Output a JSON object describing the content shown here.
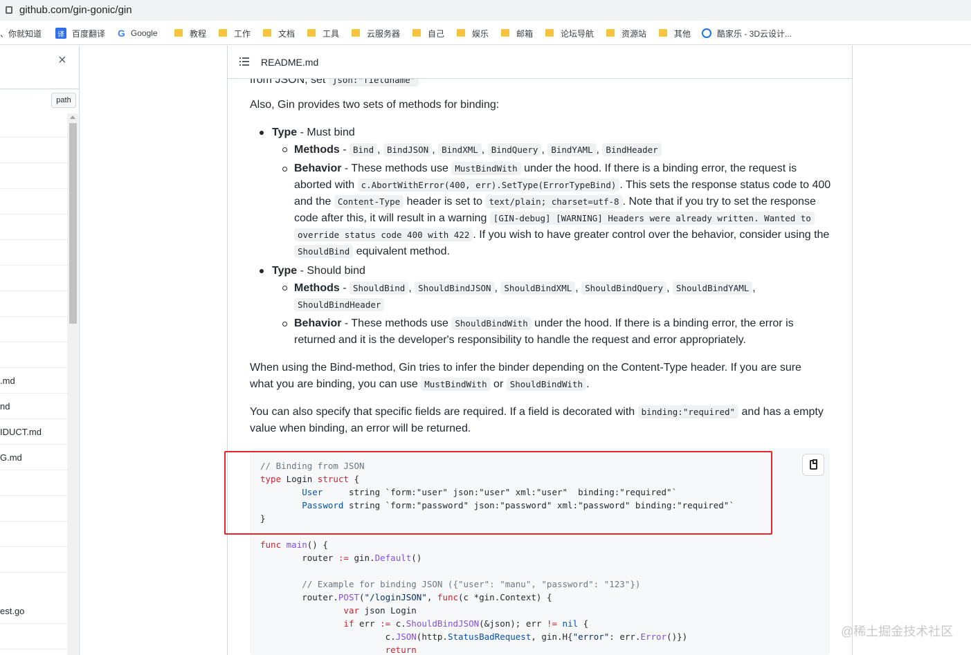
{
  "browser": {
    "url": "github.com/gin-gonic/gin",
    "bookmarks": [
      {
        "label": "、你就知道",
        "icon": "none"
      },
      {
        "label": "百度翻译",
        "icon": "baidu-translate-icon"
      },
      {
        "label": "Google",
        "icon": "google-icon"
      },
      {
        "label": "教程",
        "icon": "folder-icon"
      },
      {
        "label": "工作",
        "icon": "folder-icon"
      },
      {
        "label": "文档",
        "icon": "folder-icon"
      },
      {
        "label": "工具",
        "icon": "folder-icon"
      },
      {
        "label": "云服务器",
        "icon": "folder-icon"
      },
      {
        "label": "自己",
        "icon": "folder-icon"
      },
      {
        "label": "娱乐",
        "icon": "folder-icon"
      },
      {
        "label": "邮箱",
        "icon": "folder-icon"
      },
      {
        "label": "论坛导航",
        "icon": "folder-icon"
      },
      {
        "label": "资源站",
        "icon": "folder-icon"
      },
      {
        "label": "其他",
        "icon": "folder-icon"
      },
      {
        "label": "酷家乐 - 3D云设计...",
        "icon": "kujiale-icon"
      }
    ],
    "baidu_icon_char": "译",
    "google_icon_char": "G"
  },
  "file_panel": {
    "close_char": "×",
    "path_label": "path",
    "files": [
      ".md",
      "nd",
      "IDUCT.md",
      "G.md",
      "est.go"
    ]
  },
  "readme": {
    "title": "README.md",
    "cut_line": "from JSON, set",
    "cut_code": "json:\"fieldname\"",
    "intro": "Also, Gin provides two sets of methods for binding:",
    "type_label": "Type",
    "methods_label": "Methods",
    "behavior_label": "Behavior",
    "must": {
      "type": " - Must bind",
      "methods_dash": " - ",
      "methods": [
        "Bind",
        "BindJSON",
        "BindXML",
        "BindQuery",
        "BindYAML",
        "BindHeader"
      ],
      "b1_pre": " - These methods use ",
      "b1_code": "MustBindWith",
      "b1_post": " under the hood. If there is a binding error, the request is",
      "b2_pre": "aborted with ",
      "b2_code": "c.AbortWithError(400, err).SetType(ErrorTypeBind)",
      "b2_post": ". This sets the response status code to 400",
      "b3_pre": "and the ",
      "b3_code1": "Content-Type",
      "b3_mid": " header is set to ",
      "b3_code2": "text/plain; charset=utf-8",
      "b3_post": ". Note that if you try to set the response",
      "b4_pre": "code after this, it will result in a warning ",
      "b4_code": "[GIN-debug] [WARNING] Headers were already written. Wanted to",
      "b5_code": "override status code 400 with 422",
      "b5_post": ". If you wish to have greater control over the behavior, consider using the",
      "b6_code": "ShouldBind",
      "b6_post": " equivalent method."
    },
    "should": {
      "type": " - Should bind",
      "methods_dash": " - ",
      "methods": [
        "ShouldBind",
        "ShouldBindJSON",
        "ShouldBindXML",
        "ShouldBindQuery",
        "ShouldBindYAML"
      ],
      "methods2": "ShouldBindHeader",
      "b1_pre": " - These methods use ",
      "b1_code": "ShouldBindWith",
      "b1_post": " under the hood. If there is a binding error, the error is",
      "b2": "returned and it is the developer's responsibility to handle the request and error appropriately."
    },
    "p2_l1": "When using the Bind-method, Gin tries to infer the binder depending on the Content-Type header. If you are sure",
    "p2_l2_pre": "what you are binding, you can use ",
    "p2_l2_code1": "MustBindWith",
    "p2_l2_mid": " or ",
    "p2_l2_code2": "ShouldBindWith",
    "p2_l2_post": ".",
    "p3_l1_pre": "You can also specify that specific fields are required. If a field is decorated with ",
    "p3_l1_code": "binding:\"required\"",
    "p3_l1_post": " and has a empty",
    "p3_l2": "value when binding, an error will be returned."
  },
  "code": {
    "l1": "// Binding from JSON",
    "l2_k": "type",
    "l2_name": " Login ",
    "l2_k2": "struct",
    "l2_end": " {",
    "l3_field": "User",
    "l3_rest": "     string `form:\"user\" json:\"user\" xml:\"user\"  binding:\"required\"`",
    "l4_field": "Password",
    "l4_rest": " string `form:\"password\" json:\"password\" xml:\"password\" binding:\"required\"`",
    "l5": "}",
    "l7_k": "func",
    "l7_f": "main",
    "l7_end": "() {",
    "l8_pre": "router ",
    "l8_op": ":=",
    "l8_mid": " gin.",
    "l8_f": "Default",
    "l8_end": "()",
    "l10": "// Example for binding JSON ({\"user\": \"manu\", \"password\": \"123\"})",
    "l11_pre": "router.",
    "l11_f": "POST",
    "l11_s": "\"/loginJSON\"",
    "l11_k": "func",
    "l11_end": "(c *gin.Context) {",
    "l12_k": "var",
    "l12_rest": " json Login",
    "l13_k": "if",
    "l13_pre": " err ",
    "l13_op": ":=",
    "l13_mid": " c.",
    "l13_f": "ShouldBindJSON",
    "l13_mid2": "(&json); err ",
    "l13_op2": "!=",
    "l13_nil": " nil",
    "l13_end": " {",
    "l14_pre": "c.",
    "l14_f": "JSON",
    "l14_mid": "(http.",
    "l14_v": "StatusBadRequest",
    "l14_mid2": ", gin.H{",
    "l14_s": "\"error\"",
    "l14_mid3": ": err.",
    "l14_f2": "Error",
    "l14_end": "()})",
    "l15_k": "return"
  },
  "watermark": "@稀土掘金技术社区",
  "colors": {
    "highlight_box": "#e5242b",
    "code_bg": "#f6f8fa"
  }
}
